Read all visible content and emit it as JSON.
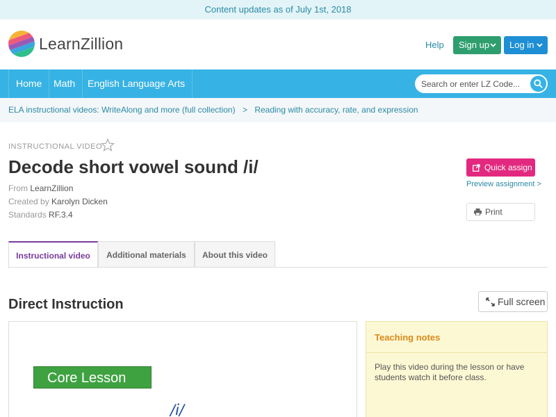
{
  "banner": {
    "text": "Content updates as of July 1st, 2018"
  },
  "header": {
    "logo_text": "LearnZillion",
    "help": "Help",
    "signup": "Sign up",
    "login": "Log in"
  },
  "nav": {
    "items": [
      "Home",
      "Math",
      "English Language Arts"
    ],
    "search_placeholder": "Search or enter LZ Code..."
  },
  "breadcrumb": {
    "items": [
      "ELA instructional videos: WriteAlong and more (full collection)",
      "Reading with accuracy, rate, and expression"
    ],
    "separator": ">"
  },
  "lesson": {
    "eyebrow": "INSTRUCTIONAL VIDEO",
    "title": "Decode short vowel sound /i/",
    "from_label": "From",
    "from_value": "LearnZillion",
    "created_label": "Created by",
    "created_value": "Karolyn Dicken",
    "standards_label": "Standards",
    "standards_value": "RF.3.4"
  },
  "actions": {
    "quick_assign": "Quick assign",
    "preview": "Preview assignment >",
    "print": "Print"
  },
  "tabs": [
    "Instructional video",
    "Additional materials",
    "About this video"
  ],
  "section": {
    "title": "Direct Instruction",
    "fullscreen": "Full screen"
  },
  "video": {
    "core_lesson": "Core Lesson",
    "phoneme": "/i/"
  },
  "notes": {
    "title": "Teaching notes",
    "body": "Play this video during the lesson or have students watch it before class."
  },
  "colors": {
    "nav_blue": "#37b2e4",
    "signup_green": "#2e9e6e",
    "login_blue": "#1e8fd4",
    "assign_pink": "#e3297f",
    "tab_active_purple": "#7a3b9e",
    "notes_orange": "#d98a1c"
  }
}
